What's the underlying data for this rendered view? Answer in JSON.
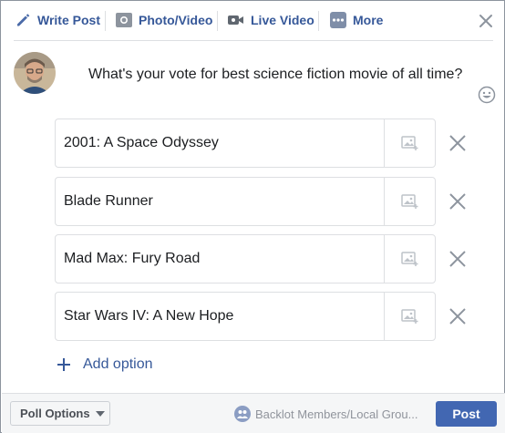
{
  "tabs": [
    {
      "label": "Write Post",
      "icon": "pencil-icon"
    },
    {
      "label": "Photo/Video",
      "icon": "photo-icon"
    },
    {
      "label": "Live Video",
      "icon": "video-camera-icon"
    },
    {
      "label": "More",
      "icon": "more-dots-icon"
    }
  ],
  "composer": {
    "question": "What's your vote for best science fiction movie of all time?"
  },
  "poll": {
    "options": [
      {
        "value": "2001: A Space Odyssey"
      },
      {
        "value": "Blade Runner"
      },
      {
        "value": "Mad Max: Fury Road"
      },
      {
        "value": "Star Wars IV: A New Hope"
      }
    ],
    "add_option_label": "Add option"
  },
  "footer": {
    "poll_options_label": "Poll Options",
    "audience_label": "Backlot Members/Local Grou...",
    "post_label": "Post"
  },
  "colors": {
    "link_blue": "#365899",
    "post_button": "#4267b2",
    "icon_gray": "#606770"
  }
}
